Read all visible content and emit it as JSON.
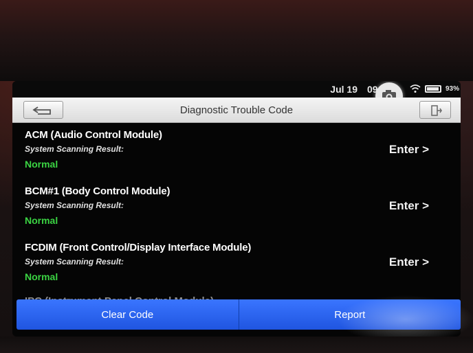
{
  "status_bar": {
    "date": "Jul 19",
    "time": "09:3",
    "battery": "93%",
    "icons": [
      "camera-icon",
      "wifi-icon",
      "battery-icon"
    ]
  },
  "title_bar": {
    "title": "Diagnostic Trouble Code",
    "back_icon": "back-arrow-icon",
    "exit_icon": "exit-icon"
  },
  "modules": [
    {
      "name": "ACM (Audio Control Module)",
      "subtitle": "System Scanning Result:",
      "status": "Normal",
      "action": "Enter >"
    },
    {
      "name": "BCM#1 (Body Control Module)",
      "subtitle": "System Scanning Result:",
      "status": "Normal",
      "action": "Enter >"
    },
    {
      "name": "FCDIM (Front Control/Display Interface Module)",
      "subtitle": "System Scanning Result:",
      "status": "Normal",
      "action": "Enter >"
    }
  ],
  "partial_row": "IPC (Instrument Panel Control Module)",
  "buttons": {
    "clear": "Clear Code",
    "report": "Report"
  },
  "colors": {
    "status_normal": "#3bd443",
    "button_blue": "#2a63f0"
  }
}
